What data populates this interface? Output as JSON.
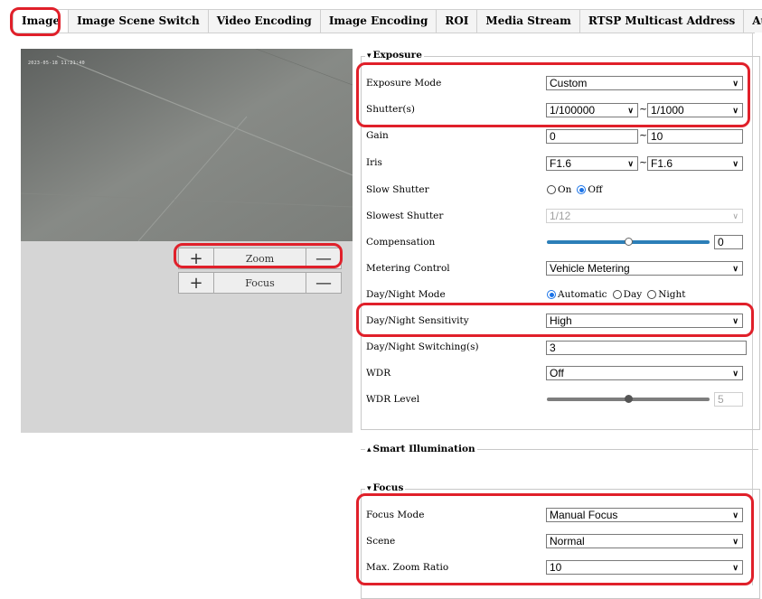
{
  "tabs": [
    "Image",
    "Image Scene Switch",
    "Video Encoding",
    "Image Encoding",
    "ROI",
    "Media Stream",
    "RTSP Multicast Address",
    "Audio"
  ],
  "preview": {
    "osd_text": "2023-05-18 11:21:40",
    "zoom": {
      "plus": "+",
      "label": "Zoom",
      "minus": "—"
    },
    "focus": {
      "plus": "+",
      "label": "Focus",
      "minus": "—"
    }
  },
  "exposure": {
    "legend": "Exposure",
    "exposure_mode": {
      "label": "Exposure Mode",
      "value": "Custom"
    },
    "shutter": {
      "label": "Shutter(s)",
      "min": "1/100000",
      "max": "1/1000"
    },
    "gain": {
      "label": "Gain",
      "min": "0",
      "max": "10"
    },
    "iris": {
      "label": "Iris",
      "min": "F1.6",
      "max": "F1.6"
    },
    "slow_shutter": {
      "label": "Slow Shutter",
      "on": "On",
      "off": "Off",
      "selected": "Off"
    },
    "slowest_shutter": {
      "label": "Slowest Shutter",
      "value": "1/12"
    },
    "compensation": {
      "label": "Compensation",
      "value": "0",
      "level": 0.5
    },
    "metering_control": {
      "label": "Metering Control",
      "value": "Vehicle Metering"
    },
    "day_night_mode": {
      "label": "Day/Night Mode",
      "automatic": "Automatic",
      "day": "Day",
      "night": "Night",
      "selected": "Automatic"
    },
    "day_night_sensitivity": {
      "label": "Day/Night Sensitivity",
      "value": "High"
    },
    "day_night_switching": {
      "label": "Day/Night Switching(s)",
      "value": "3"
    },
    "wdr": {
      "label": "WDR",
      "value": "Off"
    },
    "wdr_level": {
      "label": "WDR Level",
      "value": "5",
      "level": 0.5
    }
  },
  "smart_illumination": {
    "legend": "Smart Illumination"
  },
  "focus": {
    "legend": "Focus",
    "focus_mode": {
      "label": "Focus Mode",
      "value": "Manual Focus"
    },
    "scene": {
      "label": "Scene",
      "value": "Normal"
    },
    "max_zoom_ratio": {
      "label": "Max. Zoom Ratio",
      "value": "10"
    }
  },
  "colors": {
    "highlight": "#e0202a",
    "slider_active": "#2c7fb8",
    "radio_selected": "#1a73e8"
  },
  "icons": {
    "chevron": "chevron-down-icon",
    "legend_expand": "triangle-down-icon",
    "legend_collapsed": "triangle-up-icon"
  }
}
